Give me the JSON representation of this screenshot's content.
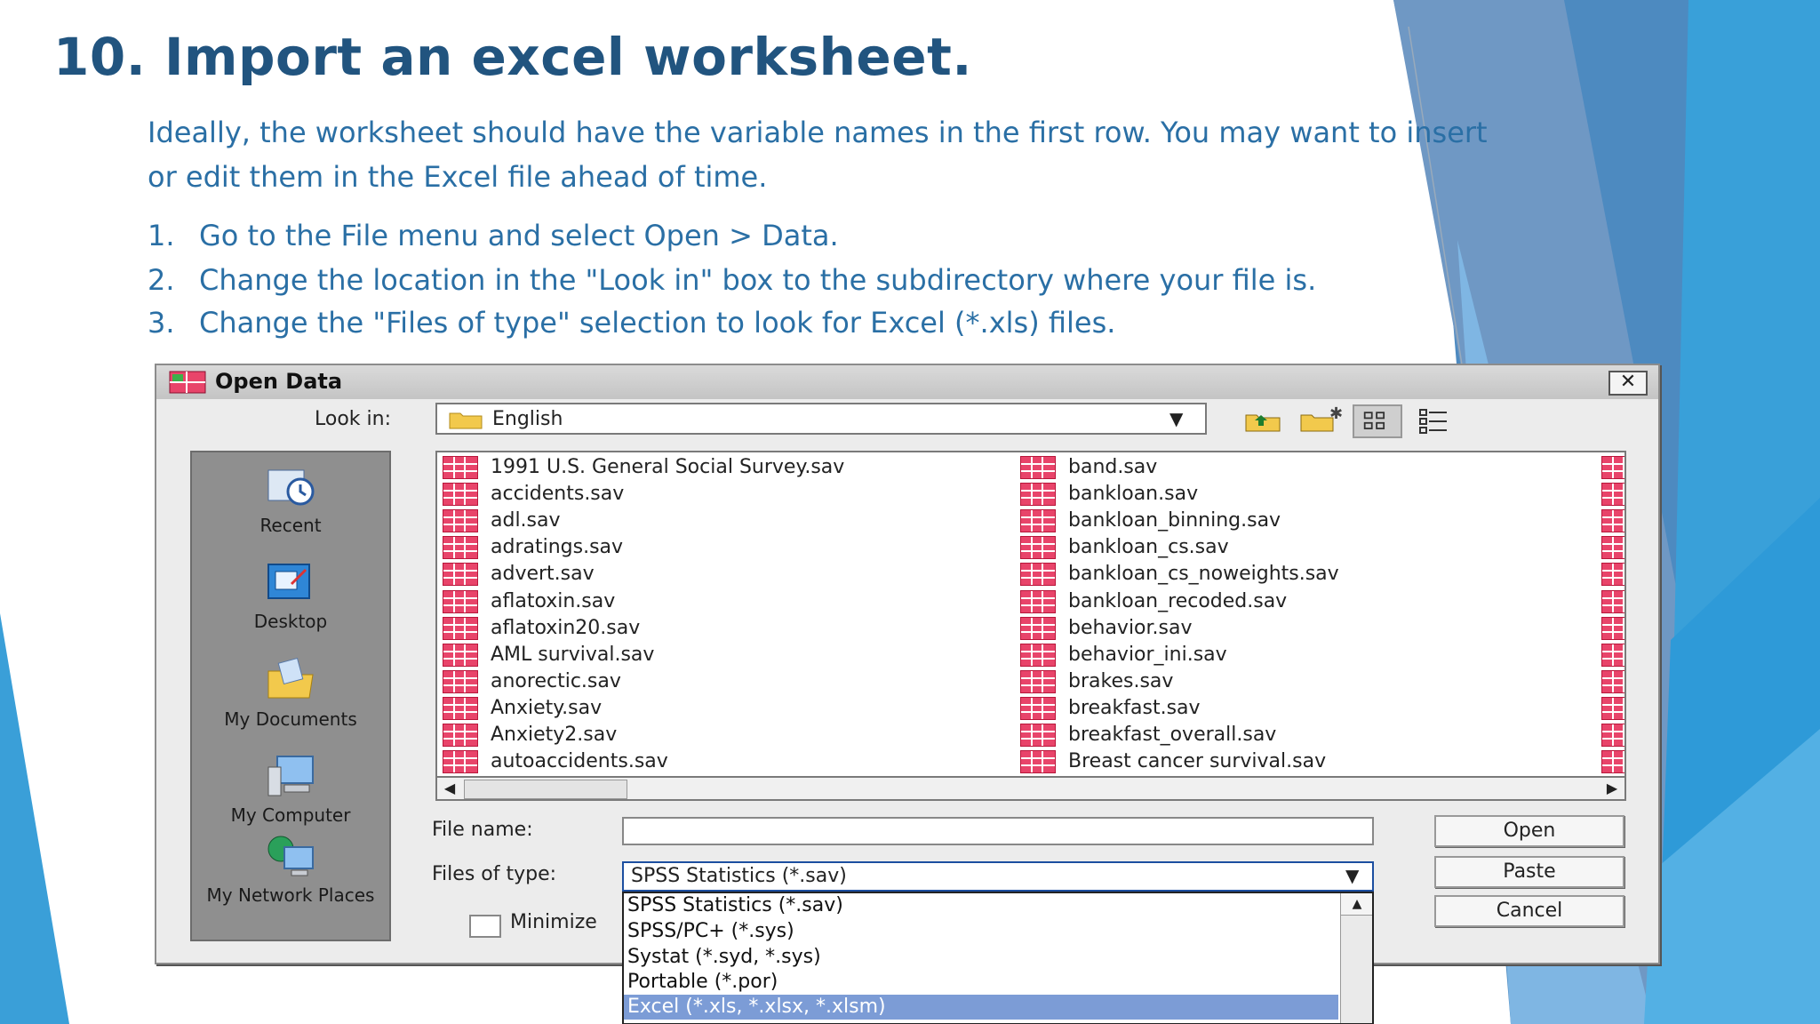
{
  "slide": {
    "title": "10. Import an excel worksheet.",
    "intro_line1": "Ideally, the worksheet should have the variable names in the first row. You may want to insert",
    "intro_line2": "or edit them in the Excel file ahead of time.",
    "steps": [
      {
        "num": "1.",
        "text": "Go to the File menu and select Open > Data."
      },
      {
        "num": "2.",
        "text": "Change the location in the \"Look in\" box to the subdirectory where your file is."
      },
      {
        "num": "3.",
        "text": "Change the \"Files of type\" selection to look for Excel (*.xls) files."
      }
    ]
  },
  "dialog": {
    "title": "Open Data",
    "close_label": "✕",
    "look_in_label": "Look in:",
    "look_in_value": "English",
    "toolbar": [
      "up-folder-icon",
      "new-folder-icon",
      "list-view-icon",
      "details-view-icon"
    ],
    "places": [
      {
        "label": "Recent",
        "icon": "recent-icon"
      },
      {
        "label": "Desktop",
        "icon": "desktop-icon"
      },
      {
        "label": "My Documents",
        "icon": "documents-icon"
      },
      {
        "label": "My Computer",
        "icon": "computer-icon"
      },
      {
        "label": "My Network Places",
        "icon": "network-icon"
      }
    ],
    "files_col1": [
      "1991 U.S. General Social Survey.sav",
      "accidents.sav",
      "adl.sav",
      "adratings.sav",
      "advert.sav",
      "aflatoxin.sav",
      "aflatoxin20.sav",
      "AML survival.sav",
      "anorectic.sav",
      "Anxiety.sav",
      "Anxiety2.sav",
      "autoaccidents.sav"
    ],
    "files_col2": [
      "band.sav",
      "bankloan.sav",
      "bankloan_binning.sav",
      "bankloan_cs.sav",
      "bankloan_cs_noweights.sav",
      "bankloan_recoded.sav",
      "behavior.sav",
      "behavior_ini.sav",
      "brakes.sav",
      "breakfast.sav",
      "breakfast_overall.sav",
      "Breast cancer survival.sav"
    ],
    "file_name_label": "File name:",
    "file_name_value": "",
    "files_of_type_label": "Files of type:",
    "files_of_type_value": "SPSS Statistics (*.sav)",
    "type_options": [
      "SPSS Statistics (*.sav)",
      "SPSS/PC+ (*.sys)",
      "Systat (*.syd, *.sys)",
      "Portable (*.por)",
      "Excel (*.xls, *.xlsx, *.xlsm)"
    ],
    "selected_option": 4,
    "minimize_label": "Minimize",
    "buttons": {
      "open": "Open",
      "paste": "Paste",
      "cancel": "Cancel"
    }
  },
  "colors": {
    "title": "#21547f",
    "body": "#2a6fa5",
    "accent_blue": "#2e8fd0",
    "dark_blue": "#3f72a3"
  }
}
